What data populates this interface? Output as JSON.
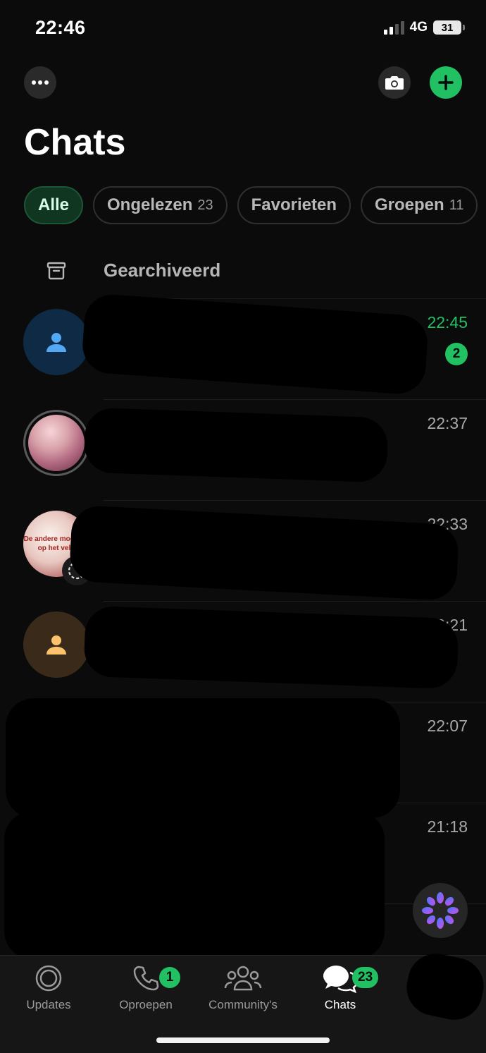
{
  "status_bar": {
    "time": "22:46",
    "network": "4G",
    "battery": "31"
  },
  "header": {
    "title": "Chats"
  },
  "filters": [
    {
      "label": "Alle",
      "count": ""
    },
    {
      "label": "Ongelezen",
      "count": "23"
    },
    {
      "label": "Favorieten",
      "count": ""
    },
    {
      "label": "Groepen",
      "count": "11"
    }
  ],
  "archived": {
    "label": "Gearchiveerd"
  },
  "chats": [
    {
      "time": "22:45",
      "unread": "2"
    },
    {
      "time": "22:37"
    },
    {
      "time": "22:33"
    },
    {
      "time": "22:21"
    },
    {
      "time": "22:07"
    },
    {
      "time": "21:18"
    }
  ],
  "avatar_text": "De andere moeders op het veld",
  "bottom_nav": {
    "updates": "Updates",
    "calls": "Oproepen",
    "calls_badge": "1",
    "communities": "Community's",
    "chats": "Chats",
    "chats_badge": "23"
  },
  "colors": {
    "accent": "#21c063",
    "background": "#0b0b0b"
  }
}
